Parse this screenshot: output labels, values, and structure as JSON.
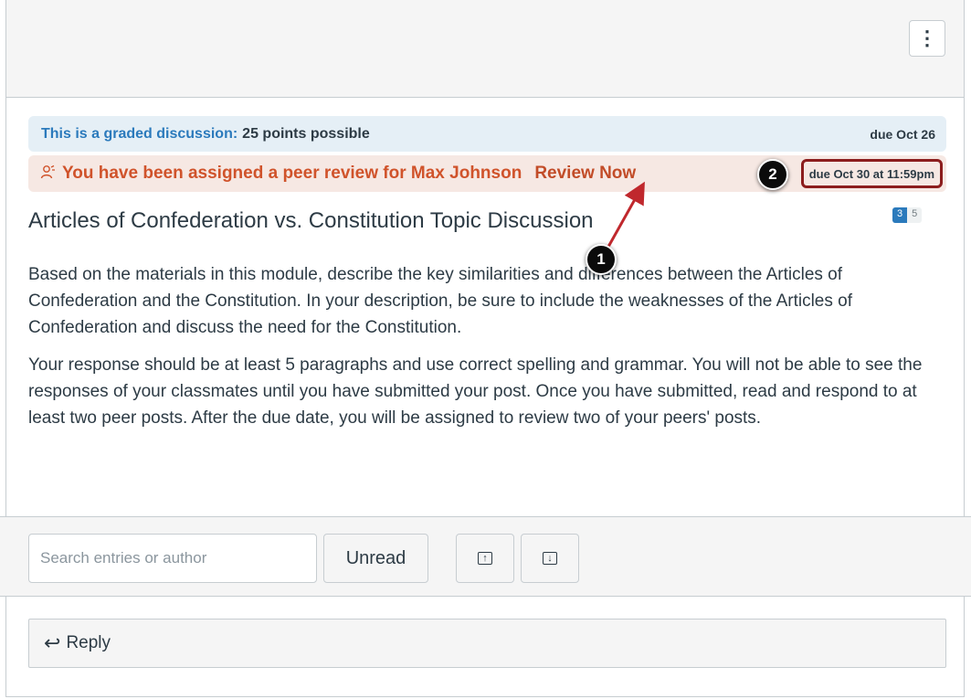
{
  "topbar": {
    "menu_icon": "kebab-menu-icon",
    "menu_glyph": "⋮"
  },
  "graded": {
    "label": "This is a graded discussion:",
    "points": "25 points possible",
    "due": "due Oct 26"
  },
  "peer_review": {
    "icon": "peer-review-icon",
    "icon_glyph": "👥",
    "message": "You have been assigned a peer review for Max Johnson",
    "review_link": "Review Now",
    "due": "due Oct 30 at 11:59pm"
  },
  "discussion": {
    "title": "Articles of Confederation vs. Constitution Topic Discussion",
    "unread_count": "3",
    "total_count": "5",
    "paragraphs": [
      "Based on the materials in this module, describe the key similarities and differences between the Articles of Confederation and the Constitution. In your description, be sure to include the weaknesses of the Articles of Confederation and discuss the need for the Constitution.",
      "Your response should be at least 5 paragraphs and use correct spelling and grammar. You will not be able to see the responses of your classmates until you have submitted your post. Once you have submitted, read and respond to at least two peer posts. After the due date, you will be assigned to review two of your peers' posts."
    ]
  },
  "toolbar": {
    "search_placeholder": "Search entries or author",
    "unread_label": "Unread",
    "collapse_icon": "collapse-threads-icon",
    "expand_icon": "expand-threads-icon",
    "collapse_glyph": "↑",
    "expand_glyph": "↓"
  },
  "reply": {
    "icon": "reply-arrow-icon",
    "icon_glyph": "↩",
    "label": "Reply"
  },
  "annotations": {
    "badge_1": "1",
    "badge_2": "2",
    "arrow_color": "#c0282d",
    "highlight_color": "#8c1d1d"
  }
}
